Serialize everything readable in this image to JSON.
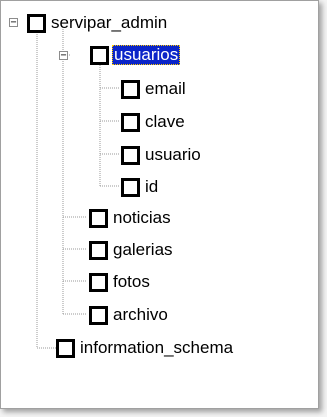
{
  "tree": {
    "root": {
      "label": "servipar_admin",
      "expander": "−",
      "children": [
        {
          "label": "usuarios",
          "selected": true,
          "expander": "−",
          "children": [
            {
              "label": "email"
            },
            {
              "label": "clave"
            },
            {
              "label": "usuario"
            },
            {
              "label": "id"
            }
          ]
        },
        {
          "label": "noticias"
        },
        {
          "label": "galerias"
        },
        {
          "label": "fotos"
        },
        {
          "label": "archivo"
        }
      ]
    },
    "sibling": {
      "label": "information_schema"
    }
  },
  "colors": {
    "selection": "#0a24c8",
    "tree_lines": "#9a9a9a"
  }
}
